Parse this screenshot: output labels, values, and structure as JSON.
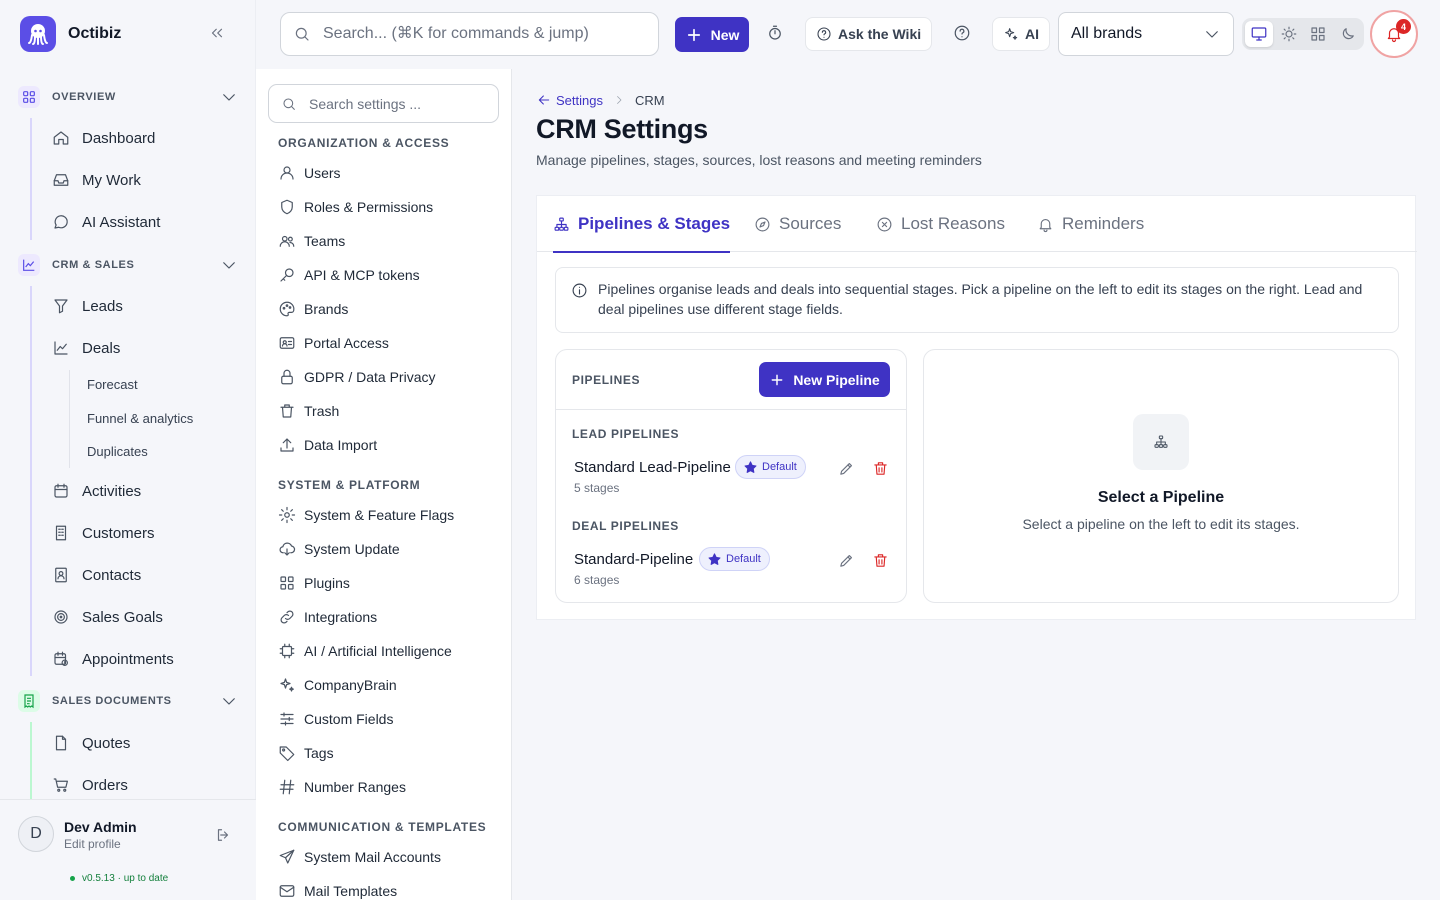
{
  "app": {
    "name": "Octibiz"
  },
  "topbar": {
    "search_placeholder": "Search... (⌘K for commands & jump)",
    "new_label": "New",
    "wiki_label": "Ask the Wiki",
    "ai_label": "AI",
    "brand_select_value": "All brands",
    "notification_count": "4"
  },
  "sidebar": {
    "sections": [
      {
        "label": "OVERVIEW",
        "icon": "grid-icon",
        "color": "#ede9fe"
      },
      {
        "label": "CRM & SALES",
        "icon": "chart-line-icon",
        "color": "#ede9fe"
      },
      {
        "label": "SALES DOCUMENTS",
        "icon": "receipt-icon",
        "color": "#dcfce7"
      }
    ],
    "overview_items": [
      {
        "label": "Dashboard",
        "icon": "home-icon"
      },
      {
        "label": "My Work",
        "icon": "inbox-icon"
      },
      {
        "label": "AI Assistant",
        "icon": "chat-icon"
      }
    ],
    "crm_items": [
      {
        "label": "Leads",
        "icon": "funnel-icon"
      },
      {
        "label": "Deals",
        "icon": "chart-line-icon"
      }
    ],
    "deal_subitems": [
      "Forecast",
      "Funnel & analytics",
      "Duplicates"
    ],
    "crm_items_after": [
      {
        "label": "Activities",
        "icon": "calendar-icon"
      },
      {
        "label": "Customers",
        "icon": "building-icon"
      },
      {
        "label": "Contacts",
        "icon": "contact-card-icon"
      },
      {
        "label": "Sales Goals",
        "icon": "target-icon"
      },
      {
        "label": "Appointments",
        "icon": "calendar-clock-icon"
      }
    ],
    "doc_items": [
      {
        "label": "Quotes",
        "icon": "file-icon"
      },
      {
        "label": "Orders",
        "icon": "cart-icon"
      }
    ],
    "user": {
      "initial": "D",
      "name": "Dev Admin",
      "sub": "Edit profile"
    },
    "version": "v0.5.13 · up to date"
  },
  "settings_nav": {
    "search_placeholder": "Search settings ...",
    "groups": [
      {
        "label": "ORGANIZATION & ACCESS"
      },
      {
        "label": "SYSTEM & PLATFORM"
      },
      {
        "label": "COMMUNICATION & TEMPLATES"
      }
    ],
    "org_items": [
      {
        "label": "Users",
        "icon": "user-icon"
      },
      {
        "label": "Roles & Permissions",
        "icon": "shield-icon"
      },
      {
        "label": "Teams",
        "icon": "users-icon"
      },
      {
        "label": "API & MCP tokens",
        "icon": "key-icon"
      },
      {
        "label": "Brands",
        "icon": "palette-icon"
      },
      {
        "label": "Portal Access",
        "icon": "id-card-icon"
      },
      {
        "label": "GDPR / Data Privacy",
        "icon": "lock-icon"
      },
      {
        "label": "Trash",
        "icon": "trash-icon"
      },
      {
        "label": "Data Import",
        "icon": "upload-icon"
      }
    ],
    "system_items": [
      {
        "label": "System & Feature Flags",
        "icon": "gear-icon"
      },
      {
        "label": "System Update",
        "icon": "cloud-download-icon"
      },
      {
        "label": "Plugins",
        "icon": "grid-icon"
      },
      {
        "label": "Integrations",
        "icon": "link-icon"
      },
      {
        "label": "AI / Artificial Intelligence",
        "icon": "cpu-icon"
      },
      {
        "label": "CompanyBrain",
        "icon": "sparkles-icon"
      },
      {
        "label": "Custom Fields",
        "icon": "sliders-icon"
      },
      {
        "label": "Tags",
        "icon": "tag-icon"
      },
      {
        "label": "Number Ranges",
        "icon": "hash-icon"
      }
    ],
    "comm_items": [
      {
        "label": "System Mail Accounts",
        "icon": "send-icon"
      },
      {
        "label": "Mail Templates",
        "icon": "mail-icon"
      }
    ]
  },
  "main": {
    "breadcrumb": {
      "back_label": "Settings",
      "current": "CRM"
    },
    "title": "CRM Settings",
    "subtitle": "Manage pipelines, stages, sources, lost reasons and meeting reminders",
    "tabs": [
      {
        "label": "Pipelines & Stages",
        "icon": "sitemap-icon",
        "active": true
      },
      {
        "label": "Sources",
        "icon": "compass-icon",
        "active": false
      },
      {
        "label": "Lost Reasons",
        "icon": "x-circle-icon",
        "active": false
      },
      {
        "label": "Reminders",
        "icon": "bell-icon",
        "active": false
      }
    ],
    "info_text": "Pipelines organise leads and deals into sequential stages. Pick a pipeline on the left to edit its stages on the right. Lead and deal pipelines use different stage fields.",
    "pipelines_panel": {
      "title": "PIPELINES",
      "new_button": "New Pipeline",
      "lead_group": "LEAD PIPELINES",
      "deal_group": "DEAL PIPELINES",
      "lead_pipelines": [
        {
          "name": "Standard Lead-Pipeline",
          "badge": "Default",
          "stages": "5 stages"
        }
      ],
      "deal_pipelines": [
        {
          "name": "Standard-Pipeline",
          "badge": "Default",
          "stages": "6 stages"
        }
      ]
    },
    "empty_state": {
      "title": "Select a Pipeline",
      "text": "Select a pipeline on the left to edit its stages."
    }
  },
  "colors": {
    "accent": "#3f33c4",
    "danger": "#dc2626",
    "success": "#16a34a"
  }
}
